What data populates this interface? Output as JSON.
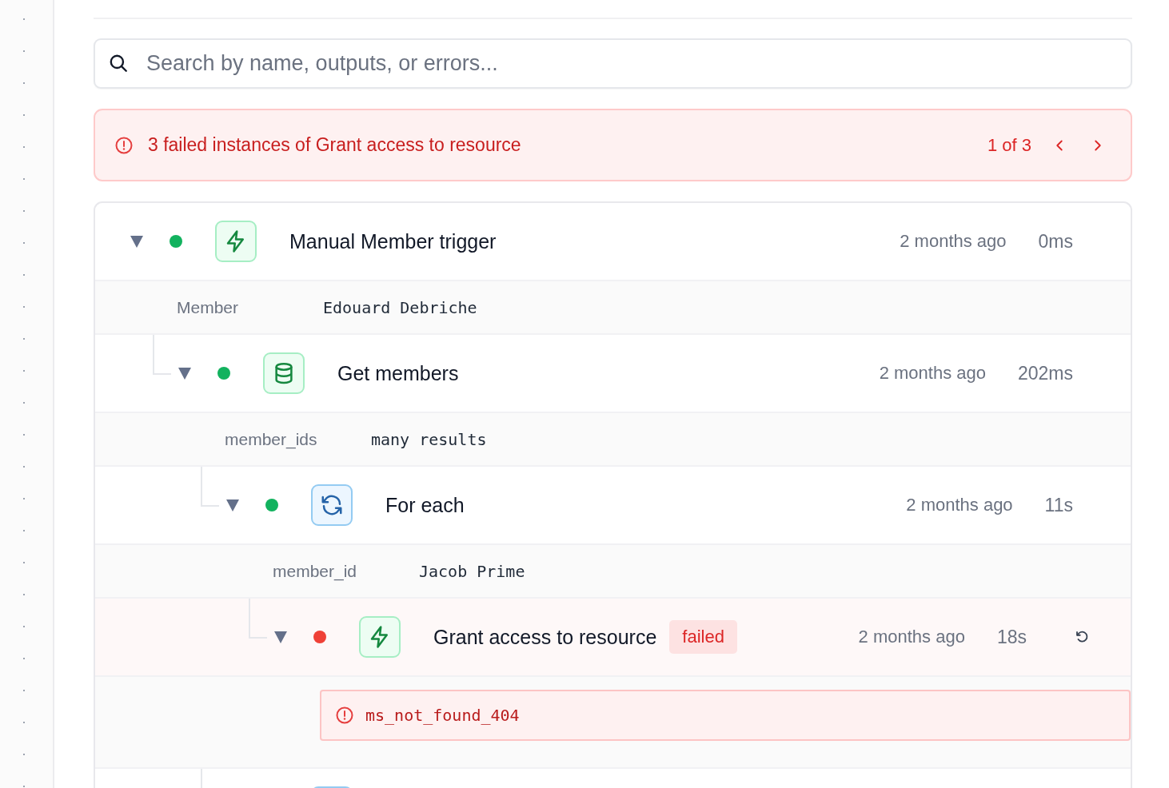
{
  "search": {
    "placeholder": "Search by name, outputs, or errors..."
  },
  "failure_banner": {
    "message": "3 failed instances of Grant access to resource",
    "position": "1 of 3"
  },
  "runs": [
    {
      "name": "Manual Member trigger",
      "kind": "trigger",
      "failed": false,
      "expanded": true,
      "time": "2 months ago",
      "duration": "0ms",
      "outputs": [
        {
          "key": "Member",
          "value": "Edouard Debriche"
        }
      ],
      "children": [
        {
          "name": "Get members",
          "kind": "database",
          "failed": false,
          "expanded": true,
          "time": "2 months ago",
          "duration": "202ms",
          "outputs": [
            {
              "key": "member_ids",
              "value": "many results"
            }
          ],
          "children": [
            {
              "name": "For each",
              "kind": "loop",
              "failed": false,
              "expanded": true,
              "time": "2 months ago",
              "duration": "11s",
              "outputs": [
                {
                  "key": "member_id",
                  "value": "Jacob Prime"
                }
              ],
              "children": [
                {
                  "name": "Grant access to resource",
                  "kind": "trigger",
                  "failed": true,
                  "badge": "failed",
                  "expanded": true,
                  "time": "2 months ago",
                  "duration": "18s",
                  "retry": true,
                  "error": "ms_not_found_404"
                }
              ]
            },
            {
              "kind": "loop"
            }
          ]
        }
      ]
    }
  ]
}
